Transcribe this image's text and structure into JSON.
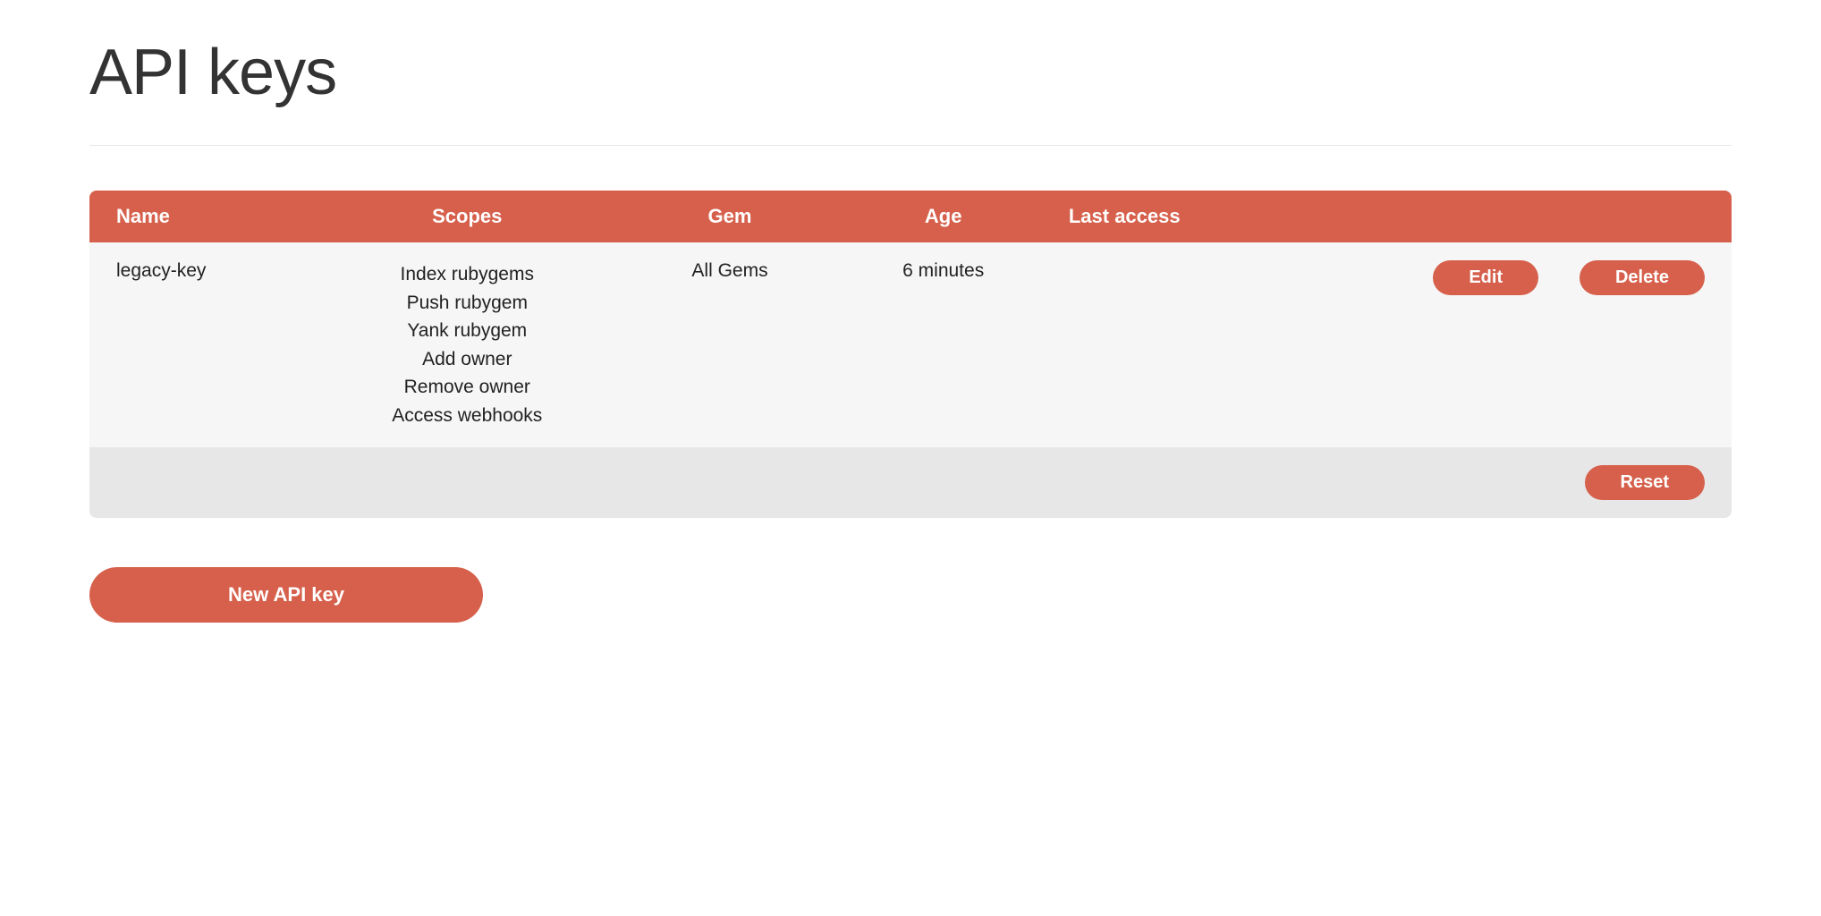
{
  "page": {
    "title": "API keys"
  },
  "table": {
    "headers": {
      "name": "Name",
      "scopes": "Scopes",
      "gem": "Gem",
      "age": "Age",
      "last_access": "Last access"
    },
    "rows": [
      {
        "name": "legacy-key",
        "scopes": [
          "Index rubygems",
          "Push rubygem",
          "Yank rubygem",
          "Add owner",
          "Remove owner",
          "Access webhooks"
        ],
        "gem": "All Gems",
        "age": "6 minutes",
        "last_access": ""
      }
    ]
  },
  "buttons": {
    "edit": "Edit",
    "delete": "Delete",
    "reset": "Reset",
    "new_api_key": "New API key"
  },
  "colors": {
    "accent": "#d6604b",
    "row_bg": "#f6f6f6",
    "footer_bg": "#e7e7e7"
  }
}
